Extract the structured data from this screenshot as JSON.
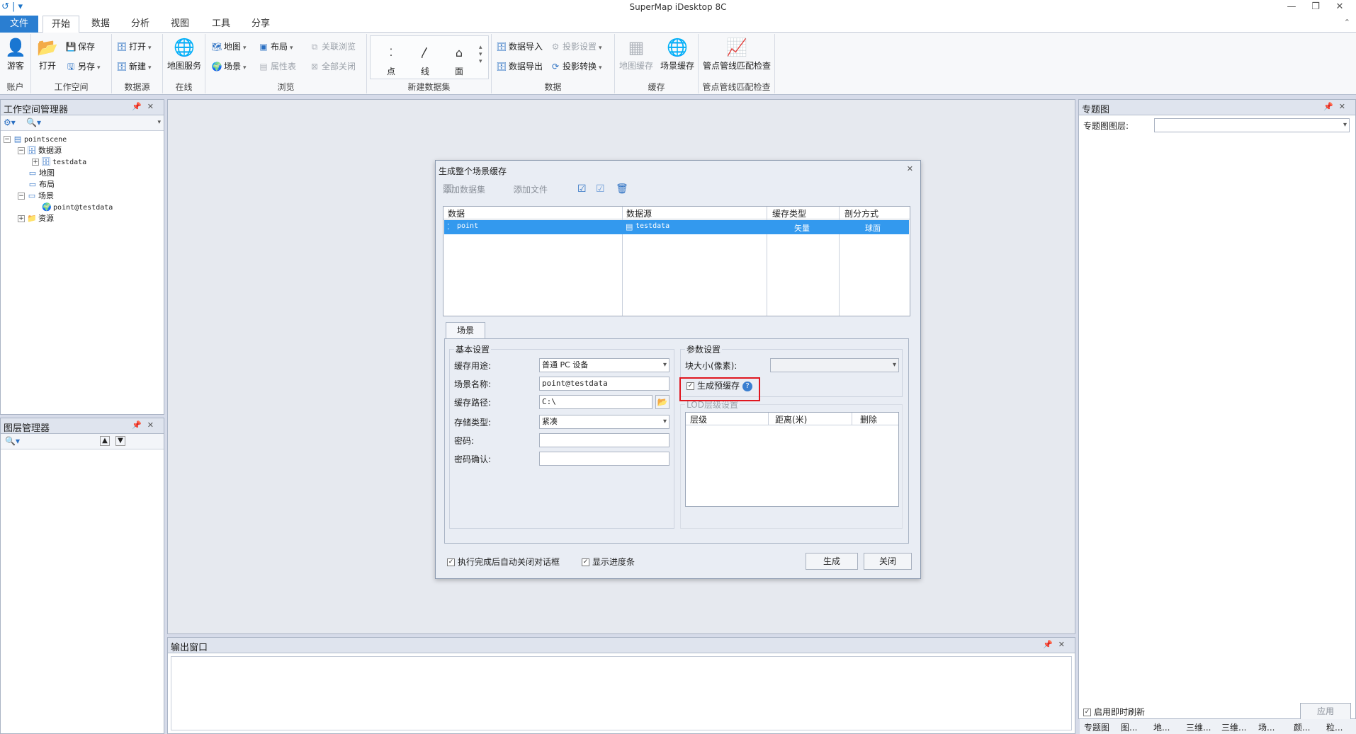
{
  "window": {
    "title": "SuperMap iDesktop 8C"
  },
  "tabs": [
    "文件",
    "开始",
    "数据",
    "分析",
    "视图",
    "工具",
    "分享"
  ],
  "ribbon": {
    "account": {
      "btn": "游客",
      "label": "账户"
    },
    "workspace": {
      "open": "打开",
      "save": "保存",
      "save_as": "另存",
      "label": "工作空间"
    },
    "datasource": {
      "open": "打开",
      "new": "新建",
      "label": "数据源"
    },
    "online": {
      "btn": "地图服务",
      "label": "在线"
    },
    "browse": {
      "map": "地图",
      "scene": "场景",
      "layout": "布局",
      "attr_table": "属性表",
      "link_browse": "关联浏览",
      "close_all": "全部关闭",
      "label": "浏览"
    },
    "new_dataset": {
      "point": "点",
      "line": "线",
      "region": "面",
      "label": "新建数据集"
    },
    "data": {
      "import": "数据导入",
      "export": "数据导出",
      "proj_set": "投影设置",
      "proj_conv": "投影转换",
      "label": "数据"
    },
    "cache": {
      "map_cache": "地图缓存",
      "scene_cache": "场景缓存",
      "label": "缓存"
    },
    "pipe": {
      "btn": "管点管线匹配检查",
      "label": "管点管线匹配检查"
    }
  },
  "workspace_panel": {
    "title": "工作空间管理器",
    "tree": [
      {
        "label": "pointscene",
        "mono": true
      },
      {
        "label": "数据源"
      },
      {
        "label": "testdata",
        "mono": true
      },
      {
        "label": "地图"
      },
      {
        "label": "布局"
      },
      {
        "label": "场景"
      },
      {
        "label": "point@testdata",
        "mono": true
      },
      {
        "label": "资源"
      }
    ]
  },
  "layer_panel": {
    "title": "图层管理器"
  },
  "output_panel": {
    "title": "输出窗口"
  },
  "thematic_panel": {
    "title": "专题图",
    "layer_label": "专题图图层:",
    "auto_refresh": "启用即时刷新",
    "apply": "应用",
    "bottom_tabs": [
      "专题图",
      "图...",
      "地...",
      "三维...",
      "三维...",
      "场...",
      "颜...",
      "粒..."
    ]
  },
  "dialog": {
    "title": "生成整个场景缓存",
    "toolbar": {
      "add_dataset": "添加数据集",
      "add_file": "添加文件"
    },
    "columns": [
      "数据",
      "数据源",
      "缓存类型",
      "剖分方式"
    ],
    "rows": [
      {
        "data": "point",
        "datasource": "testdata",
        "cache_type": "矢量",
        "split": "球面"
      }
    ],
    "tab": "场景",
    "basic": {
      "legend": "基本设置",
      "usage_label": "缓存用途:",
      "usage_value": "普通 PC 设备",
      "name_label": "场景名称:",
      "name_value": "point@testdata",
      "path_label": "缓存路径:",
      "path_value": "C:\\",
      "storage_label": "存储类型:",
      "storage_value": "紧凑",
      "password_label": "密码:",
      "confirm_label": "密码确认:"
    },
    "params": {
      "legend": "参数设置",
      "tile_label": "块大小(像素):",
      "pregen": "生成预缓存",
      "lod_legend": "LOD层级设置",
      "lod_columns": [
        "层级",
        "距离(米)",
        "删除"
      ]
    },
    "auto_close": "执行完成后自动关闭对话框",
    "show_progress": "显示进度条",
    "generate": "生成",
    "close": "关闭"
  }
}
